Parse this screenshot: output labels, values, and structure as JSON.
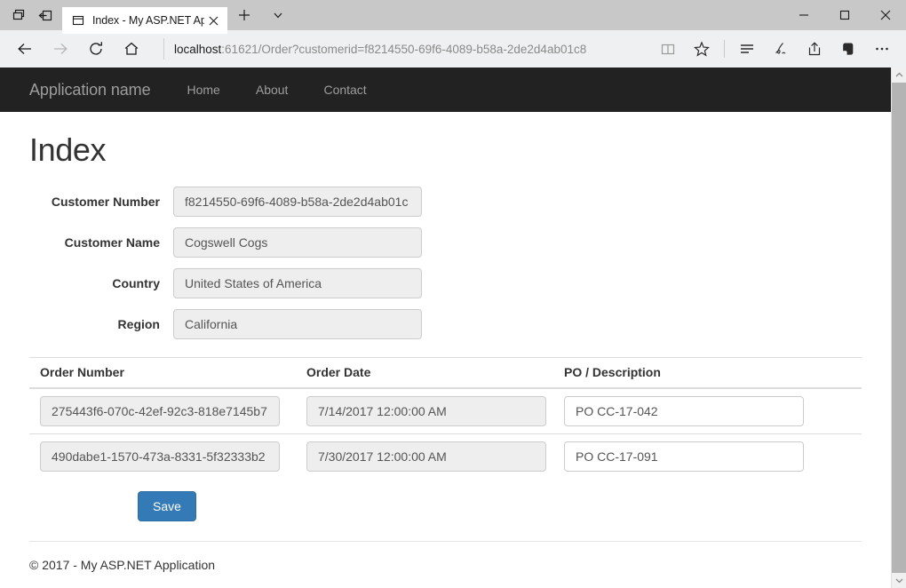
{
  "browser": {
    "window_title": "Index - My ASP.NET Application",
    "tab_title": "Index - My ASP.NET Ap",
    "tab_icons": {
      "tab_preview": "tab-preview-icon",
      "set_tabs_aside": "set-tabs-aside-icon",
      "favicon": "page-favicon",
      "close": "close-tab-icon",
      "new_tab": "new-tab-icon",
      "tab_dropdown": "chevron-down-icon"
    },
    "nav": {
      "back": "back-arrow-icon",
      "forward": "forward-arrow-icon",
      "refresh": "refresh-icon",
      "home": "home-icon"
    },
    "url_host": "localhost",
    "url_rest": ":61621/Order?customerid=f8214550-69f6-4089-b58a-2de2d4ab01c8",
    "toolbar_icons": [
      "reading-view-icon",
      "favorites-star-icon",
      "hub-icon",
      "web-note-pen-icon",
      "share-icon",
      "evernote-extension-icon",
      "more-ellipsis-icon"
    ],
    "window_controls": {
      "minimize": "minimize-icon",
      "maximize": "maximize-icon",
      "close": "close-icon"
    },
    "scrollbar": {
      "up": "scroll-up-arrow-icon",
      "down": "scroll-down-arrow-icon"
    }
  },
  "site": {
    "brand": "Application name",
    "nav_links": [
      {
        "label": "Home"
      },
      {
        "label": "About"
      },
      {
        "label": "Contact"
      }
    ],
    "page_title": "Index",
    "fields": [
      {
        "label": "Customer Number",
        "value": "f8214550-69f6-4089-b58a-2de2d4ab01c",
        "readonly": true
      },
      {
        "label": "Customer Name",
        "value": "Cogswell Cogs",
        "readonly": true
      },
      {
        "label": "Country",
        "value": "United States of America",
        "readonly": true
      },
      {
        "label": "Region",
        "value": "California",
        "readonly": true
      }
    ],
    "orders_table": {
      "columns": [
        "Order Number",
        "Order Date",
        "PO / Description"
      ],
      "rows": [
        {
          "order_number": "275443f6-070c-42ef-92c3-818e7145b7",
          "order_date": "7/14/2017 12:00:00 AM",
          "po_description": "PO CC-17-042"
        },
        {
          "order_number": "490dabe1-1570-473a-8331-5f32333b2",
          "order_date": "7/30/2017 12:00:00 AM",
          "po_description": "PO CC-17-091"
        }
      ]
    },
    "save_label": "Save",
    "footer": "© 2017 - My ASP.NET Application",
    "colors": {
      "navbar_bg": "#222222",
      "navbar_link": "#9d9d9d",
      "primary_button": "#337ab7",
      "readonly_input_bg": "#eeeeee",
      "text": "#333333"
    }
  }
}
